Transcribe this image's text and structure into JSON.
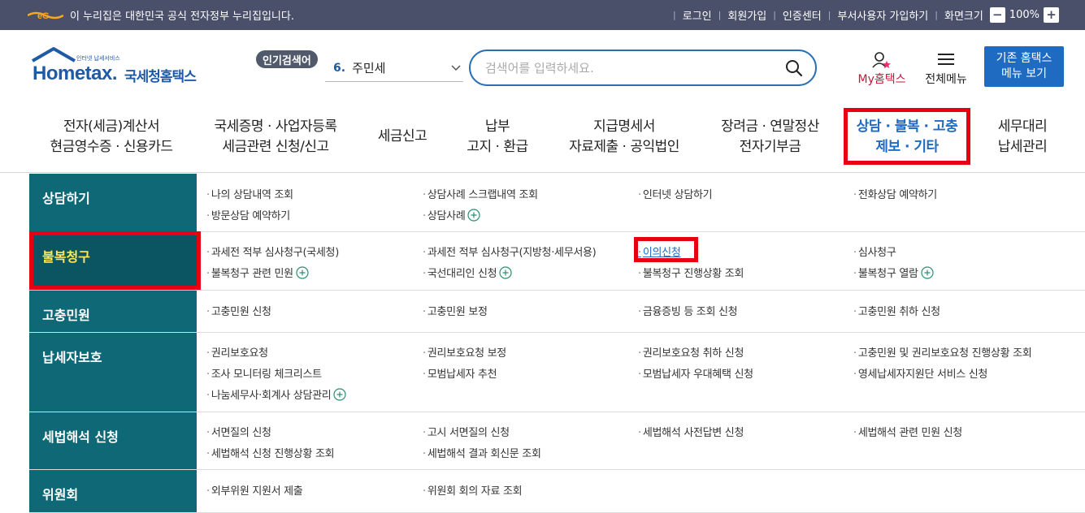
{
  "gov_bar": {
    "notice": "이 누리집은 대한민국 공식 전자정부 누리집입니다.",
    "links": [
      "로그인",
      "회원가입",
      "인증센터",
      "부서사용자 가입하기",
      "화면크기"
    ],
    "zoom": "100%",
    "zoom_minus": "−",
    "zoom_plus": "+"
  },
  "logo": {
    "small": "인터넷 납세서비스",
    "main": "Hometax.",
    "kr": "국세청홈택스"
  },
  "popular": {
    "tag": "인기검색어",
    "rank": "6.",
    "keyword": "주민세"
  },
  "search": {
    "placeholder": "검색어를 입력하세요."
  },
  "header_buttons": {
    "my_hometax": "My홈택스",
    "all_menu": "전체메뉴",
    "old_line1": "기존 홈택스",
    "old_line2": "메뉴 보기"
  },
  "gnb": [
    {
      "line1": "전자(세금)계산서",
      "line2": "현금영수증 · 신용카드"
    },
    {
      "line1": "국세증명 · 사업자등록",
      "line2": "세금관련 신청/신고"
    },
    {
      "line1": "세금신고",
      "line2": ""
    },
    {
      "line1": "납부",
      "line2": "고지 · 환급"
    },
    {
      "line1": "지급명세서",
      "line2": "자료제출 · 공익법인"
    },
    {
      "line1": "장려금 · 연말정산",
      "line2": "전자기부금"
    },
    {
      "line1": "상담 · 불복 · 고충",
      "line2": "제보 · 기타"
    },
    {
      "line1": "세무대리",
      "line2": "납세관리"
    }
  ],
  "mega": [
    {
      "category": "상담하기",
      "links": [
        "나의 상담내역 조회",
        "상담사례 스크랩내역 조회",
        "인터넷 상담하기",
        "전화상담 예약하기",
        "방문상담 예약하기",
        "상담사례"
      ]
    },
    {
      "category": "불복청구",
      "links": [
        "과세전 적부 심사청구(국세청)",
        "과세전 적부 심사청구(지방청·세무서용)",
        "이의신청",
        "심사청구",
        "불복청구 관련 민원",
        "국선대리인 신청",
        "불복청구 진행상황 조회",
        "불복청구 열람"
      ]
    },
    {
      "category": "고충민원",
      "links": [
        "고충민원 신청",
        "고충민원 보정",
        "금융증빙 등 조회 신청",
        "고충민원 취하 신청"
      ]
    },
    {
      "category": "납세자보호",
      "links": [
        "권리보호요청",
        "권리보호요청 보정",
        "권리보호요청 취하 신청",
        "고충민원 및 권리보호요청 진행상황 조회",
        "조사 모니터링 체크리스트",
        "모범납세자 추천",
        "모범납세자 우대혜택 신청",
        "영세납세자지원단 서비스 신청",
        "나눔세무사·회계사 상담관리"
      ]
    },
    {
      "category": "세법해석 신청",
      "links": [
        "서면질의 신청",
        "고시 서면질의 신청",
        "세법해석 사전답변 신청",
        "세법해석 관련 민원 신청",
        "세법해석 신청 진행상황 조회",
        "세법해석 결과 회신문 조회"
      ]
    },
    {
      "category": "위원회",
      "links": [
        "외부위원 지원서 제출",
        "위원회 회의 자료 조회"
      ]
    }
  ],
  "colors": {
    "accent": "#1f6bc1",
    "category_bg": "#0f6876",
    "highlight": "#e60012"
  }
}
